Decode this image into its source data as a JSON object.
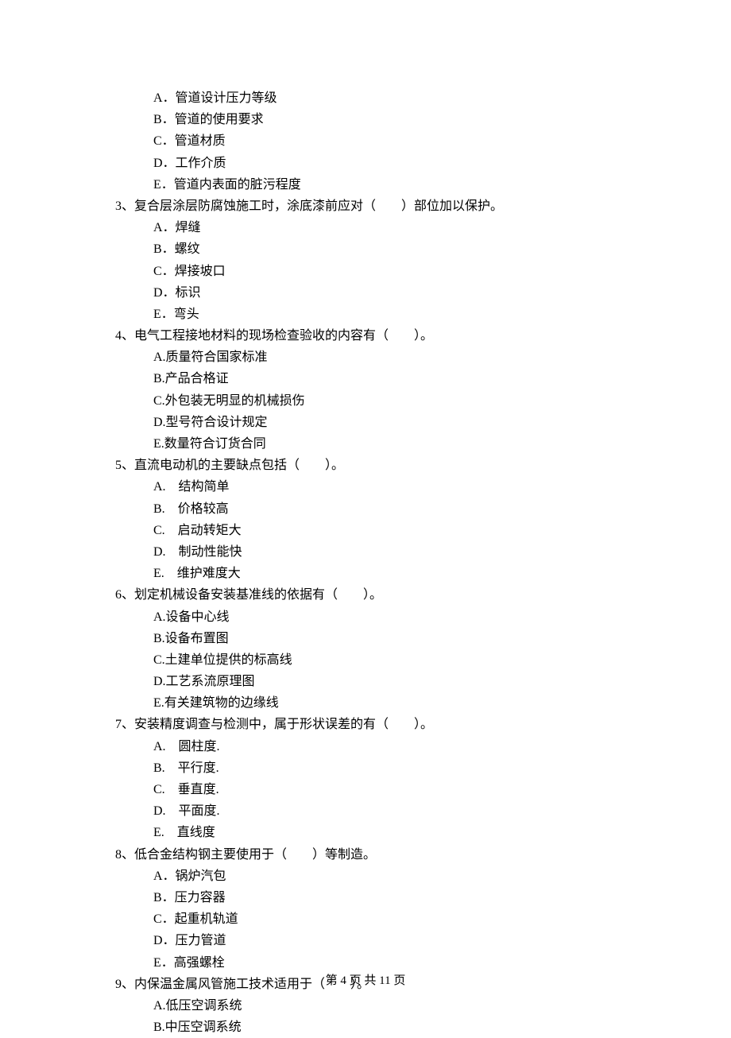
{
  "intro_options": [
    "A．管道设计压力等级",
    "B．管道的使用要求",
    "C．管道材质",
    "D．工作介质",
    "E．管道内表面的脏污程度"
  ],
  "questions": [
    {
      "stem": "3、复合层涂层防腐蚀施工时，涂底漆前应对（　　）部位加以保护。",
      "options": [
        "A．焊缝",
        "B．螺纹",
        "C．焊接坡口",
        "D．标识",
        "E．弯头"
      ]
    },
    {
      "stem": "4、电气工程接地材料的现场检查验收的内容有（　　）。",
      "options": [
        "A.质量符合国家标准",
        "B.产品合格证",
        "C.外包装无明显的机械损伤",
        "D.型号符合设计规定",
        "E.数量符合订货合同"
      ]
    },
    {
      "stem": "5、直流电动机的主要缺点包括（　　）。",
      "options": [
        "A.　结构简单",
        "B.　价格较高",
        "C.　启动转矩大",
        "D.　制动性能快",
        "E.　维护难度大"
      ]
    },
    {
      "stem": "6、划定机械设备安装基准线的依据有（　　）。",
      "options": [
        "A.设备中心线",
        "B.设备布置图",
        "C.土建单位提供的标高线",
        "D.工艺系流原理图",
        "E.有关建筑物的边缘线"
      ]
    },
    {
      "stem": "7、安装精度调查与检测中，属于形状误差的有（　　）。",
      "options": [
        "A.　圆柱度.",
        "B.　平行度.",
        "C.　垂直度.",
        "D.　平面度.",
        "E.　直线度"
      ]
    },
    {
      "stem": "8、低合金结构钢主要使用于（　　）等制造。",
      "options": [
        "A．锅炉汽包",
        "B．压力容器",
        "C．起重机轨道",
        "D．压力管道",
        "E．高强螺栓"
      ]
    },
    {
      "stem": "9、内保温金属风管施工技术适用于（　　）。",
      "options": [
        "A.低压空调系统",
        "B.中压空调系统"
      ]
    }
  ],
  "footer": "第 4 页 共 11 页"
}
